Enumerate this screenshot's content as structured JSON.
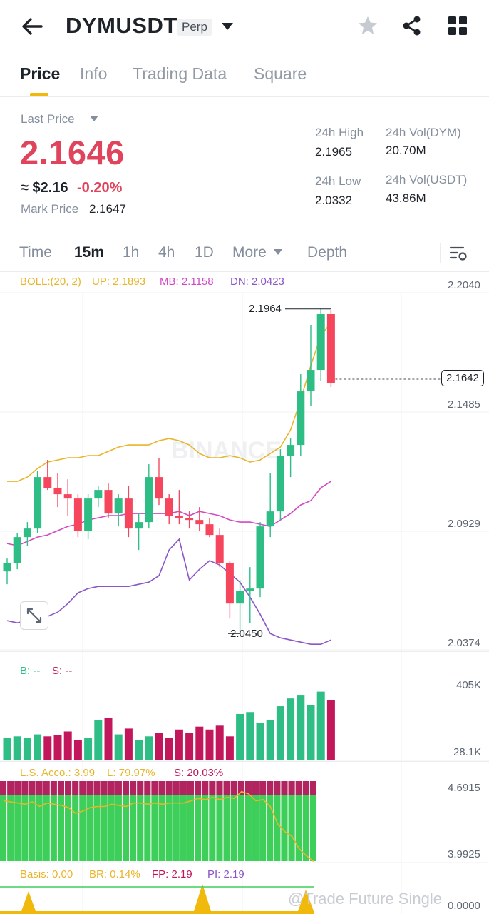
{
  "header": {
    "symbol": "DYMUSDT",
    "badge": "Perp",
    "icons": [
      "back-arrow-icon",
      "chevron-down-icon",
      "star-icon",
      "share-icon",
      "grid-icon"
    ]
  },
  "tabs": [
    "Price",
    "Info",
    "Trading Data",
    "Square"
  ],
  "active_tab": "Price",
  "ticker": {
    "last_price_label": "Last Price",
    "last_price": "2.1646",
    "usd_value": "≈ $2.16",
    "change": "-0.20%",
    "mark_label": "Mark Price",
    "mark_price": "2.1647",
    "high_label": "24h High",
    "high": "2.1965",
    "low_label": "24h Low",
    "low": "2.0332",
    "vol_dym_label": "24h Vol(DYM)",
    "vol_dym": "20.70M",
    "vol_usdt_label": "24h Vol(USDT)",
    "vol_usdt": "43.86M"
  },
  "timeframes": [
    "Time",
    "15m",
    "1h",
    "4h",
    "1D",
    "More",
    "Depth"
  ],
  "active_timeframe": "15m",
  "boll": {
    "label": "BOLL:(20, 2)",
    "up": "UP: 2.1893",
    "mb": "MB: 2.1158",
    "dn": "DN: 2.0423"
  },
  "price_axis": [
    "2.2040",
    "2.1485",
    "2.0929",
    "2.0374"
  ],
  "current_price_tag": "2.1642",
  "high_marker": "2.1964",
  "low_marker": "2.0450",
  "watermark": "BINANCE",
  "volume": {
    "b_label": "B: --",
    "s_label": "S: --",
    "axis": [
      "405K",
      "28.1K"
    ]
  },
  "ls": {
    "acco": "L.S. Acco.: 3.99",
    "l": "L: 79.97%",
    "s": "S: 20.03%",
    "axis": [
      "4.6915",
      "3.9925"
    ]
  },
  "basis": {
    "basis": "Basis: 0.00",
    "br": "BR: 0.14%",
    "fp": "FP: 2.19",
    "pi": "PI: 2.19",
    "axis_bottom": "0.0000"
  },
  "footer_watermark": "@Trade Future Single",
  "colors": {
    "up": "#2ebd85",
    "down": "#f6465d",
    "accent": "#f0b90b",
    "boll_up": "#e8b52a",
    "boll_mb": "#d14ac2",
    "boll_dn": "#8a55c8"
  },
  "chart_data": {
    "type": "candlestick",
    "interval": "15m",
    "ylim": [
      2.0374,
      2.204
    ],
    "candles": [
      [
        2.074,
        2.08,
        2.068,
        2.078
      ],
      [
        2.078,
        2.092,
        2.075,
        2.09
      ],
      [
        2.09,
        2.097,
        2.086,
        2.094
      ],
      [
        2.094,
        2.121,
        2.092,
        2.118
      ],
      [
        2.118,
        2.126,
        2.112,
        2.113
      ],
      [
        2.113,
        2.12,
        2.104,
        2.11
      ],
      [
        2.11,
        2.117,
        2.1,
        2.108
      ],
      [
        2.108,
        2.11,
        2.09,
        2.093
      ],
      [
        2.093,
        2.11,
        2.089,
        2.108
      ],
      [
        2.108,
        2.114,
        2.104,
        2.112
      ],
      [
        2.112,
        2.115,
        2.099,
        2.101
      ],
      [
        2.101,
        2.11,
        2.095,
        2.108
      ],
      [
        2.108,
        2.114,
        2.09,
        2.094
      ],
      [
        2.094,
        2.101,
        2.084,
        2.097
      ],
      [
        2.097,
        2.124,
        2.094,
        2.118
      ],
      [
        2.118,
        2.127,
        2.105,
        2.108
      ],
      [
        2.108,
        2.11,
        2.096,
        2.1
      ],
      [
        2.1,
        2.112,
        2.096,
        2.099
      ],
      [
        2.099,
        2.102,
        2.094,
        2.098
      ],
      [
        2.098,
        2.104,
        2.093,
        2.096
      ],
      [
        2.096,
        2.099,
        2.09,
        2.091
      ],
      [
        2.091,
        2.094,
        2.076,
        2.078
      ],
      [
        2.078,
        2.079,
        2.052,
        2.059
      ],
      [
        2.059,
        2.07,
        2.045,
        2.065
      ],
      [
        2.065,
        2.076,
        2.05,
        2.066
      ],
      [
        2.066,
        2.097,
        2.062,
        2.095
      ],
      [
        2.095,
        2.12,
        2.09,
        2.102
      ],
      [
        2.102,
        2.131,
        2.098,
        2.128
      ],
      [
        2.128,
        2.136,
        2.118,
        2.133
      ],
      [
        2.133,
        2.166,
        2.128,
        2.158
      ],
      [
        2.158,
        2.189,
        2.151,
        2.168
      ],
      [
        2.168,
        2.197,
        2.163,
        2.194
      ],
      [
        2.194,
        2.196,
        2.16,
        2.162
      ]
    ],
    "boll_up": [
      2.116,
      2.116,
      2.118,
      2.122,
      2.125,
      2.126,
      2.127,
      2.127,
      2.128,
      2.128,
      2.13,
      2.132,
      2.133,
      2.133,
      2.133,
      2.135,
      2.136,
      2.135,
      2.133,
      2.129,
      2.127,
      2.127,
      2.128,
      2.127,
      2.125,
      2.126,
      2.129,
      2.132,
      2.14,
      2.154,
      2.17,
      2.184,
      2.19
    ],
    "boll_mb": [
      2.087,
      2.086,
      2.088,
      2.09,
      2.091,
      2.093,
      2.095,
      2.096,
      2.098,
      2.099,
      2.1,
      2.1,
      2.101,
      2.101,
      2.101,
      2.101,
      2.101,
      2.102,
      2.1,
      2.102,
      2.101,
      2.1,
      2.098,
      2.097,
      2.097,
      2.096,
      2.095,
      2.098,
      2.101,
      2.105,
      2.107,
      2.113,
      2.116
    ],
    "boll_dn": [
      2.051,
      2.05,
      2.051,
      2.051,
      2.053,
      2.055,
      2.059,
      2.064,
      2.066,
      2.067,
      2.067,
      2.067,
      2.067,
      2.068,
      2.069,
      2.072,
      2.084,
      2.089,
      2.07,
      2.075,
      2.079,
      2.077,
      2.073,
      2.069,
      2.062,
      2.054,
      2.045,
      2.043,
      2.042,
      2.041,
      2.04,
      2.04,
      2.042
    ],
    "volume": [
      45,
      48,
      45,
      52,
      48,
      50,
      58,
      40,
      44,
      82,
      86,
      52,
      64,
      40,
      48,
      55,
      45,
      62,
      55,
      68,
      62,
      70,
      48,
      94,
      98,
      75,
      82,
      110,
      126,
      132,
      112,
      140,
      122
    ],
    "volume_ylim": [
      0,
      160
    ],
    "ls_ratio": [
      4.52,
      4.51,
      4.5,
      4.49,
      4.51,
      4.47,
      4.5,
      4.49,
      4.48,
      4.46,
      4.41,
      4.43,
      4.46,
      4.47,
      4.47,
      4.49,
      4.48,
      4.47,
      4.5,
      4.5,
      4.49,
      4.5,
      4.49,
      4.5,
      4.5,
      4.5,
      4.52,
      4.54,
      4.53,
      4.55,
      4.53,
      4.55,
      4.54,
      4.6,
      4.58,
      4.52,
      4.53,
      4.47,
      4.32,
      4.25,
      4.21,
      4.1,
      4.04,
      3.99
    ],
    "ls_ylim": [
      3.9925,
      4.6915
    ]
  }
}
